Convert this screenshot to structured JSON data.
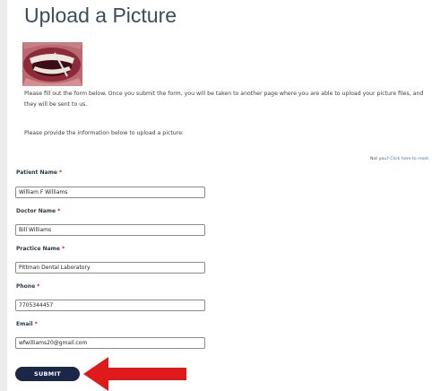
{
  "page": {
    "title": "Upload a Picture",
    "intro": "Please fill out the form below. Once you submit the form, you will be taken to another page where you are able to upload your picture files, and they will be sent to us.",
    "provide": "Please provide the information below to upload a picture:",
    "not_you_prefix": "Not you? ",
    "not_you_link": "Click here to reset"
  },
  "form": {
    "required_mark": "*",
    "fields": [
      {
        "label": "Patient Name",
        "value": "William F Williams"
      },
      {
        "label": "Doctor Name",
        "value": "Bill Williams"
      },
      {
        "label": "Practice Name",
        "value": "Pittman Dental Laboratory"
      },
      {
        "label": "Phone",
        "value": "7705344457"
      },
      {
        "label": "Email",
        "value": "wfwilliams20@gmail.com"
      }
    ],
    "submit_label": "SUBMIT"
  },
  "colors": {
    "accent": "#1b2748",
    "required": "#cc1e1e",
    "arrow": "#e01a1a"
  },
  "icons": {
    "annotation": "red-arrow-icon"
  }
}
